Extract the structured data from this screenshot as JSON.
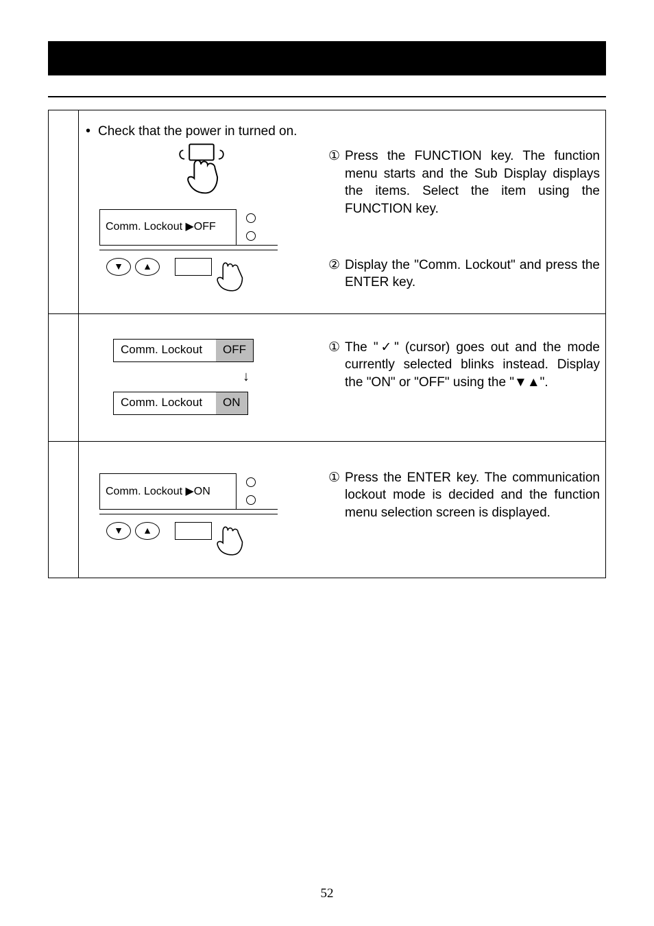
{
  "page_number": "52",
  "row1": {
    "bullet": "Check that the power in turned on.",
    "step1": "Press the FUNCTION key.  The function menu starts and the Sub Display displays the items.  Select the item using the FUNCTION key.",
    "step2": "Display the \"Comm. Lockout\" and press the ENTER key.",
    "lcd": "Comm. Lockout  ▶OFF"
  },
  "row2": {
    "step1": "The \"✓\" (cursor) goes out and the mode currently selected blinks instead.  Display the \"ON\" or \"OFF\" using the \"▼▲\".",
    "lcd_a_label": "Comm. Lockout",
    "lcd_a_val": "OFF",
    "lcd_b_label": "Comm. Lockout",
    "lcd_b_val": "ON"
  },
  "row3": {
    "step1": "Press the ENTER key.  The communication lockout mode is decided and the function menu selection screen is displayed.",
    "lcd": "Comm. Lockout   ▶ON"
  },
  "circled": {
    "one": "①",
    "two": "②"
  },
  "arrows": {
    "down": "↓",
    "tri_down": "▼",
    "tri_up": "▲"
  }
}
